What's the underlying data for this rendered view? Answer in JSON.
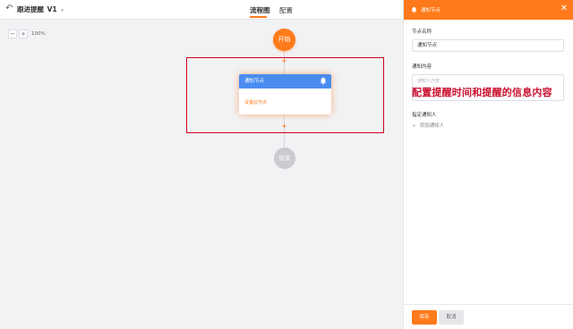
{
  "header": {
    "back_icon": "back-arrow-icon",
    "app_title": "跟进提醒",
    "version": "V1",
    "caret": "▾",
    "tabs": [
      {
        "label": "流程图",
        "active": true
      },
      {
        "label": "配置",
        "active": false
      }
    ]
  },
  "canvas": {
    "zoom_out": "−",
    "zoom_in": "+",
    "zoom_level": "100%",
    "start_node": "开始",
    "end_node": "结束",
    "add_symbol": "+",
    "notify_node": {
      "title": "通知节点",
      "icon": "bell-icon",
      "body": "设置此节点"
    }
  },
  "panel": {
    "title": "通知节点",
    "icon": "bell-icon",
    "close": "✕",
    "node_name_label": "节点名称",
    "node_name_value": "通知节点",
    "content_label": "通知内容",
    "content_placeholder": "通知人内容",
    "annotation": "配置提醒时间和提醒的信息内容",
    "recipient_label": "指定通知人",
    "add_recipient": "添加通知人",
    "add_recipient_icon": "+",
    "save": "保存",
    "cancel": "取消"
  },
  "colors": {
    "accent": "#ff7a1a",
    "node_header": "#4a8cf0",
    "highlight": "#d0021b"
  }
}
